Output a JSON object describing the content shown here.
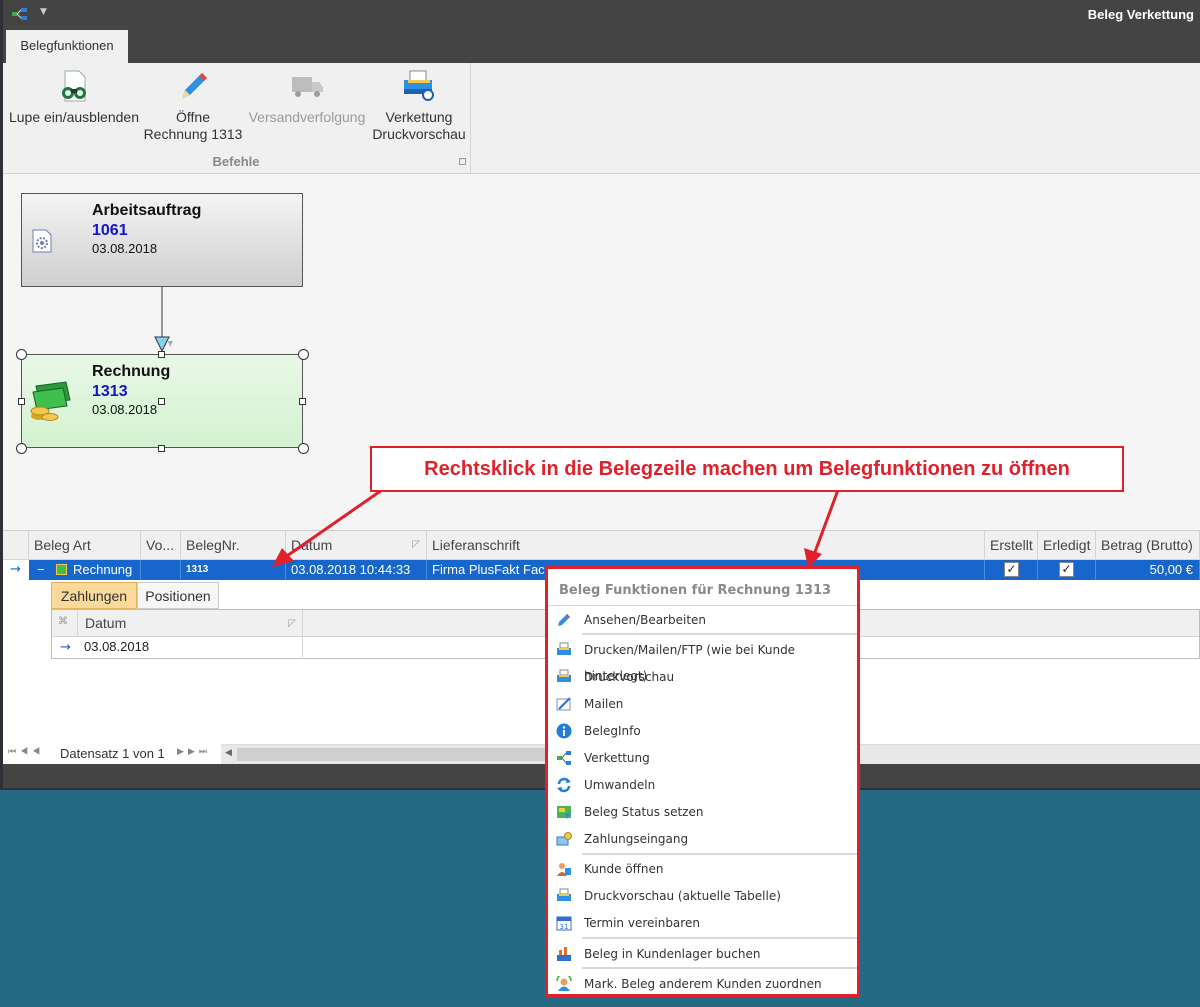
{
  "window": {
    "title": "Beleg Verkettung"
  },
  "ribbon": {
    "tab": "Belegfunktionen",
    "buttons": [
      {
        "label": "Lupe ein/ausblenden",
        "icon": "binoculars-icon"
      },
      {
        "label": "Öffne\nRechnung 1313",
        "icon": "pencil-icon"
      },
      {
        "label": "Versandverfolgung",
        "icon": "truck-icon",
        "disabled": true
      },
      {
        "label": "Verkettung\nDruckvorschau",
        "icon": "printer-preview-icon"
      }
    ],
    "group": "Befehle"
  },
  "diagram": {
    "nodes": [
      {
        "title": "Arbeitsauftrag",
        "number": "1061",
        "date": "03.08.2018"
      },
      {
        "title": "Rechnung",
        "number": "1313",
        "date": "03.08.2018"
      }
    ]
  },
  "callout": "Rechtsklick in die Belegzeile machen um Belegfunktionen zu öffnen",
  "grid": {
    "columns": [
      "Beleg Art",
      "Vo...",
      "BelegNr.",
      "Datum",
      "Lieferanschrift",
      "Erstellt",
      "Erledigt",
      "Betrag (Brutto)"
    ],
    "row": {
      "art": "Rechnung",
      "nr": "1313",
      "datum": "03.08.2018 10:44:33",
      "lieferanschrift": "Firma PlusFakt Fac",
      "betrag": "50,00 €"
    },
    "subtabs": [
      "Zahlungen",
      "Positionen"
    ],
    "subgrid": {
      "column": "Datum",
      "value": "03.08.2018"
    }
  },
  "pager": {
    "text": "Datensatz 1 von 1"
  },
  "context_menu": {
    "header": "Beleg Funktionen für Rechnung 1313",
    "items": [
      "Ansehen/Bearbeiten",
      "Drucken/Mailen/FTP (wie bei Kunde hinterlegt)",
      "Druckvorschau",
      "Mailen",
      "BelegInfo",
      "Verkettung",
      "Umwandeln",
      "Beleg Status setzen",
      "Zahlungseingang",
      "Kunde öffnen",
      "Druckvorschau (aktuelle Tabelle)",
      "Termin vereinbaren",
      "Beleg in Kundenlager buchen",
      "Mark. Beleg  anderem Kunden zuordnen"
    ]
  },
  "colors": {
    "accent": "#1666cc",
    "callout": "#e0202b",
    "chrome": "#444444"
  }
}
